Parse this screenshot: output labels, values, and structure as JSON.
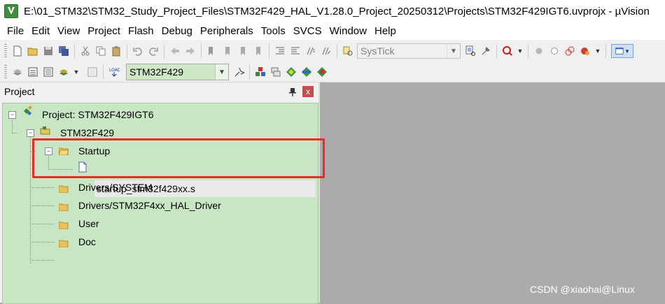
{
  "window": {
    "title": "E:\\01_STM32\\STM32_Study_Project_Files\\STM32F429_HAL_V1.28.0_Project_20250312\\Projects\\STM32F429IGT6.uvprojx - µVision",
    "icon": "uvision-app-icon"
  },
  "menu": {
    "items": [
      "File",
      "Edit",
      "View",
      "Project",
      "Flash",
      "Debug",
      "Peripherals",
      "Tools",
      "SVCS",
      "Window",
      "Help"
    ]
  },
  "toolbar": {
    "find_combo_value": "SysTick",
    "target_combo_value": "STM32F429"
  },
  "project_panel": {
    "title": "Project",
    "close_label": "x",
    "tree": {
      "root": "Project: STM32F429IGT6",
      "target": "STM32F429",
      "groups": [
        {
          "name": "Startup",
          "files": [
            "startup_stm32f429xx.s"
          ],
          "expanded": true
        },
        {
          "name": "Drivers/SYSTEM"
        },
        {
          "name": "Drivers/STM32F4xx_HAL_Driver"
        },
        {
          "name": "User"
        },
        {
          "name": "Doc"
        }
      ]
    },
    "expander_collapse": "−"
  },
  "colors": {
    "tree_background": "#c9e6c4",
    "highlight_border": "#ee2a24",
    "editor_area": "#ababab"
  },
  "watermark": "CSDN @xiaohai@Linux"
}
